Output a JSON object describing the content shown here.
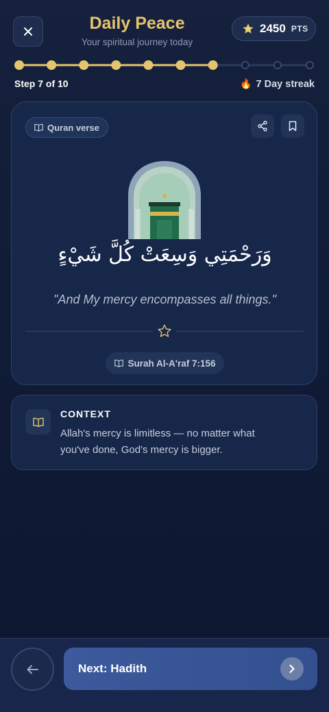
{
  "header": {
    "title": "Daily Peace",
    "subtitle": "Your spiritual journey today",
    "points_value": "2450",
    "points_unit": "PTS",
    "close_icon": "close-icon",
    "star_icon": "star-icon"
  },
  "progress": {
    "current_step": 7,
    "total_steps": 10,
    "step_label": "Step 7 of 10",
    "streak_label": "7 Day streak",
    "streak_icon": "fire-icon"
  },
  "verse_card": {
    "tag_label": "Quran verse",
    "arabic": "وَرَحْمَتِي وَسِعَتْ كُلَّ شَيْءٍ",
    "translation": "\"And My mercy encompasses all things.\"",
    "reference": "Surah Al-A'raf 7:156",
    "share_icon": "share-icon",
    "bookmark_icon": "bookmark-icon"
  },
  "context": {
    "title": "CONTEXT",
    "body": "Allah's mercy is limitless — no matter what you've done, God's mercy is bigger."
  },
  "footer": {
    "next_label": "Next: Hadith",
    "back_icon": "arrow-left-icon",
    "next_icon": "chevron-right-icon"
  },
  "colors": {
    "accent_gold": "#e6c36e",
    "background": "#111c36",
    "card": "#17274a",
    "next_button": "#3c5a9c"
  }
}
